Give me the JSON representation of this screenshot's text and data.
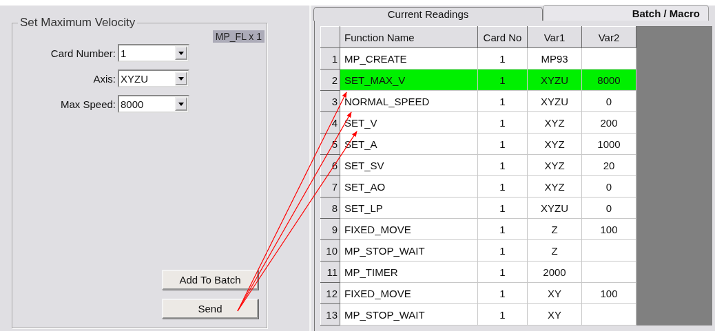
{
  "group": {
    "title": "Set Maximum Velocity",
    "badge": "MP_FL x 1",
    "fields": [
      {
        "label": "Card Number:",
        "value": "1"
      },
      {
        "label": "Axis:",
        "value": "XYZU"
      },
      {
        "label": "Max Speed:",
        "value": "8000"
      }
    ],
    "buttons": [
      "Add To Batch",
      "Send"
    ]
  },
  "tabs": [
    {
      "label": "Current Readings",
      "selected": false
    },
    {
      "label": "Batch / Macro",
      "selected": true
    }
  ],
  "table": {
    "columns": [
      "Function Name",
      "Card No",
      "Var1",
      "Var2"
    ],
    "rows": [
      {
        "number": "1",
        "cells": [
          "MP_CREATE",
          "1",
          "MP93",
          ""
        ],
        "selected": false
      },
      {
        "number": "2",
        "cells": [
          "SET_MAX_V",
          "1",
          "XYZU",
          "8000"
        ],
        "selected": true
      },
      {
        "number": "3",
        "cells": [
          "NORMAL_SPEED",
          "1",
          "XYZU",
          "0"
        ],
        "selected": false
      },
      {
        "number": "4",
        "cells": [
          "SET_V",
          "1",
          "XYZ",
          "200"
        ],
        "selected": false
      },
      {
        "number": "5",
        "cells": [
          "SET_A",
          "1",
          "XYZ",
          "1000"
        ],
        "selected": false
      },
      {
        "number": "6",
        "cells": [
          "SET_SV",
          "1",
          "XYZ",
          "20"
        ],
        "selected": false
      },
      {
        "number": "7",
        "cells": [
          "SET_AO",
          "1",
          "XYZ",
          "0"
        ],
        "selected": false
      },
      {
        "number": "8",
        "cells": [
          "SET_LP",
          "1",
          "XYZU",
          "0"
        ],
        "selected": false
      },
      {
        "number": "9",
        "cells": [
          "FIXED_MOVE",
          "1",
          "Z",
          "100"
        ],
        "selected": false
      },
      {
        "number": "10",
        "cells": [
          "MP_STOP_WAIT",
          "1",
          "Z",
          ""
        ],
        "selected": false
      },
      {
        "number": "11",
        "cells": [
          "MP_TIMER",
          "1",
          "2000",
          ""
        ],
        "selected": false
      },
      {
        "number": "12",
        "cells": [
          "FIXED_MOVE",
          "1",
          "XY",
          "100"
        ],
        "selected": false
      },
      {
        "number": "13",
        "cells": [
          "MP_STOP_WAIT",
          "1",
          "XY",
          ""
        ],
        "selected": false
      }
    ]
  }
}
